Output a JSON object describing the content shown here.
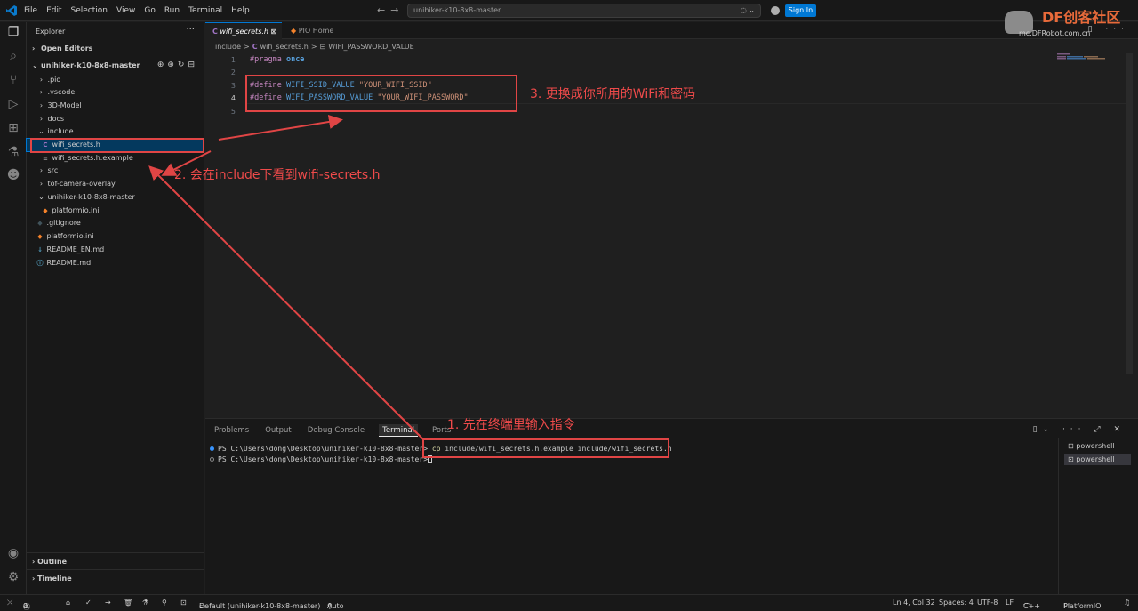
{
  "titlebar": {
    "menu": [
      "File",
      "Edit",
      "Selection",
      "View",
      "Go",
      "Run",
      "Terminal",
      "Help"
    ],
    "search_text": "unihiker-k10-8x8-master",
    "sign_in": "Sign In",
    "watermark_brand": "DF创客社区",
    "watermark_url": "mc.DFRobot.com.cn"
  },
  "sidebar": {
    "title": "Explorer",
    "open_editors": "Open Editors",
    "root": "unihiker-k10-8x8-master",
    "items": [
      {
        "label": ".pio",
        "icon": "chevron-right"
      },
      {
        "label": ".vscode",
        "icon": "chevron-right"
      },
      {
        "label": "3D-Model",
        "icon": "chevron-right"
      },
      {
        "label": "docs",
        "icon": "chevron-right"
      },
      {
        "label": "include",
        "icon": "chevron-down"
      },
      {
        "label": "wifi_secrets.h",
        "icon": "c-file"
      },
      {
        "label": "wifi_secrets.h.example",
        "icon": "example-file"
      },
      {
        "label": "src",
        "icon": "chevron-right"
      },
      {
        "label": "tof-camera-overlay",
        "icon": "chevron-right"
      },
      {
        "label": "unihiker-k10-8x8-master",
        "icon": "chevron-down"
      },
      {
        "label": "platformio.ini",
        "icon": "platformio-file"
      },
      {
        "label": ".gitignore",
        "icon": "git-file"
      },
      {
        "label": "platformio.ini",
        "icon": "platformio-file"
      },
      {
        "label": "README_EN.md",
        "icon": "markdown-file"
      },
      {
        "label": "README.md",
        "icon": "info-file"
      }
    ],
    "outline": "Outline",
    "timeline": "Timeline"
  },
  "tabs": [
    {
      "label": "wifi_secrets.h",
      "active": true
    },
    {
      "label": "PIO Home",
      "active": false
    }
  ],
  "breadcrumb": [
    "include",
    ">",
    "wifi_secrets.h",
    ">",
    "WIFI_PASSWORD_VALUE"
  ],
  "editor": {
    "line_numbers": [
      "1",
      "2",
      "3",
      "4",
      "5"
    ],
    "line1_pp": "#pragma",
    "line1_kw": "once",
    "line3_pp": "#define",
    "line3_macro": "WIFI_SSID_VALUE",
    "line3_str": "\"YOUR_WIFI_SSID\"",
    "line4_pp": "#define",
    "line4_macro": "WIFI_PASSWORD_VALUE",
    "line4_str": "\"YOUR_WIFI_PASSWORD\""
  },
  "panel": {
    "tabs": [
      "Problems",
      "Output",
      "Debug Console",
      "Terminal",
      "Ports"
    ],
    "active_tab": "Terminal",
    "term_prompt1": "PS C:\\Users\\dong\\Desktop\\unihiker-k10-8x8-master>",
    "term_cmd1": "cp",
    "term_args1": "include/wifi_secrets.h.example include/wifi_secrets.h",
    "term_prompt2": "PS C:\\Users\\dong\\Desktop\\unihiker-k10-8x8-master>",
    "terminals": [
      "powershell",
      "powershell"
    ]
  },
  "statusbar": {
    "errors": "0",
    "warnings": "0",
    "env": "Default (unihiker-k10-8x8-master)",
    "auto": "Auto",
    "position": "Ln 4, Col 32",
    "spaces": "Spaces: 4",
    "encoding": "UTF-8",
    "eol": "LF",
    "language": "C++",
    "platformio": "PlatformIO"
  },
  "annotations": {
    "step1": "1. 先在终端里输入指令",
    "step2": "2. 会在include下看到wifi-secrets.h",
    "step3": "3. 更换成你所用的WiFi和密码"
  },
  "colors": {
    "accent": "#0078d4",
    "annotation": "#e04545"
  }
}
